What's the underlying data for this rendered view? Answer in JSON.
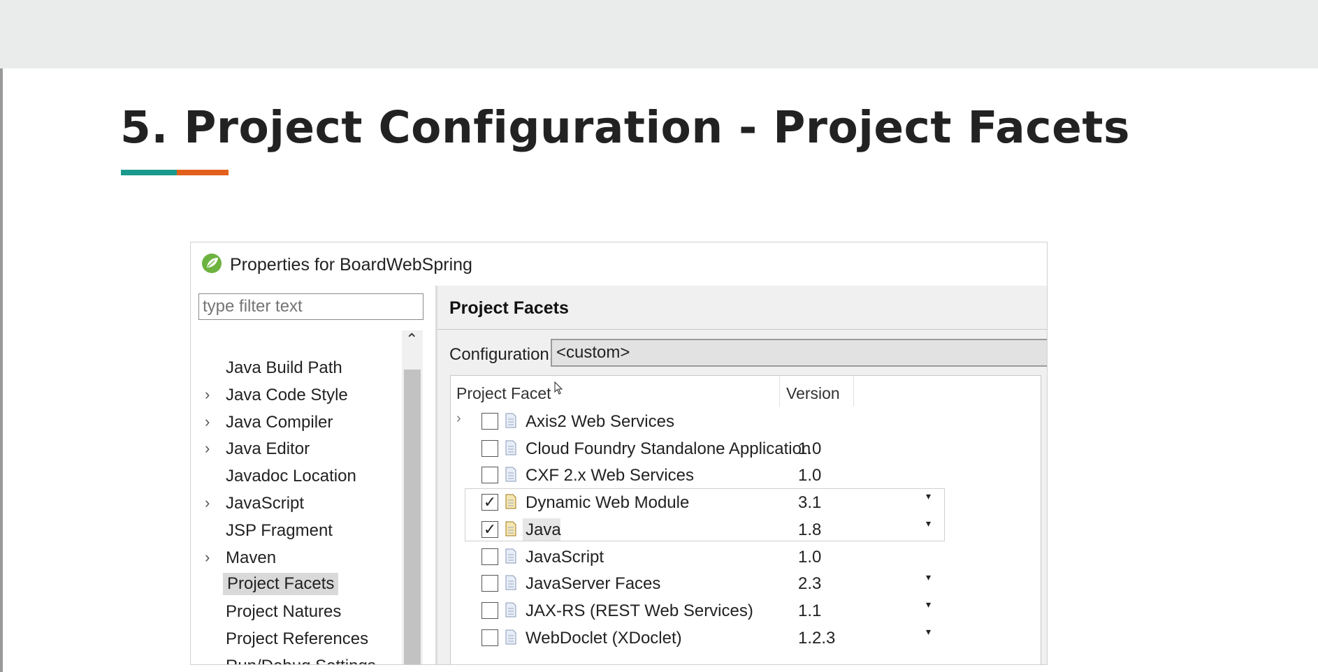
{
  "slide": {
    "title": "5.  Project Configuration - Project Facets",
    "accent_colors": [
      "#1a9a8c",
      "#e2601b"
    ]
  },
  "dialog": {
    "icon": "spring-leaf-icon",
    "title": "Properties for BoardWebSpring",
    "filter_placeholder": "type filter text",
    "tree": [
      {
        "label": "Java Build Path",
        "expandable": false
      },
      {
        "label": "Java Code Style",
        "expandable": true
      },
      {
        "label": "Java Compiler",
        "expandable": true
      },
      {
        "label": "Java Editor",
        "expandable": true
      },
      {
        "label": "Javadoc Location",
        "expandable": false
      },
      {
        "label": "JavaScript",
        "expandable": true
      },
      {
        "label": "JSP Fragment",
        "expandable": false
      },
      {
        "label": "Maven",
        "expandable": true
      },
      {
        "label": "Project Facets",
        "expandable": false,
        "selected": true
      },
      {
        "label": "Project Natures",
        "expandable": false
      },
      {
        "label": "Project References",
        "expandable": false
      },
      {
        "label": "Run/Debug Settings",
        "expandable": false
      }
    ],
    "page_title": "Project Facets",
    "configuration_label": "Configuration:",
    "configuration_value": "<custom>",
    "columns": {
      "facet": "Project Facet",
      "version": "Version"
    },
    "facets": [
      {
        "name": "Axis2 Web Services",
        "version": "",
        "checked": false,
        "expandable": true,
        "dropdown": false
      },
      {
        "name": "Cloud Foundry Standalone Application",
        "version": "1.0",
        "checked": false,
        "expandable": false,
        "dropdown": false
      },
      {
        "name": "CXF 2.x Web Services",
        "version": "1.0",
        "checked": false,
        "expandable": false,
        "dropdown": false
      },
      {
        "name": "Dynamic Web Module",
        "version": "3.1",
        "checked": true,
        "expandable": false,
        "dropdown": true
      },
      {
        "name": "Java",
        "version": "1.8",
        "checked": true,
        "expandable": false,
        "dropdown": true
      },
      {
        "name": "JavaScript",
        "version": "1.0",
        "checked": false,
        "expandable": false,
        "dropdown": false
      },
      {
        "name": "JavaServer Faces",
        "version": "2.3",
        "checked": false,
        "expandable": false,
        "dropdown": true
      },
      {
        "name": "JAX-RS (REST Web Services)",
        "version": "1.1",
        "checked": false,
        "expandable": false,
        "dropdown": true
      },
      {
        "name": "WebDoclet (XDoclet)",
        "version": "1.2.3",
        "checked": false,
        "expandable": false,
        "dropdown": true
      }
    ],
    "glyphs": {
      "chevron": "›",
      "check": "✓",
      "dropdown": "▾",
      "scroll_up": "⌃"
    }
  }
}
